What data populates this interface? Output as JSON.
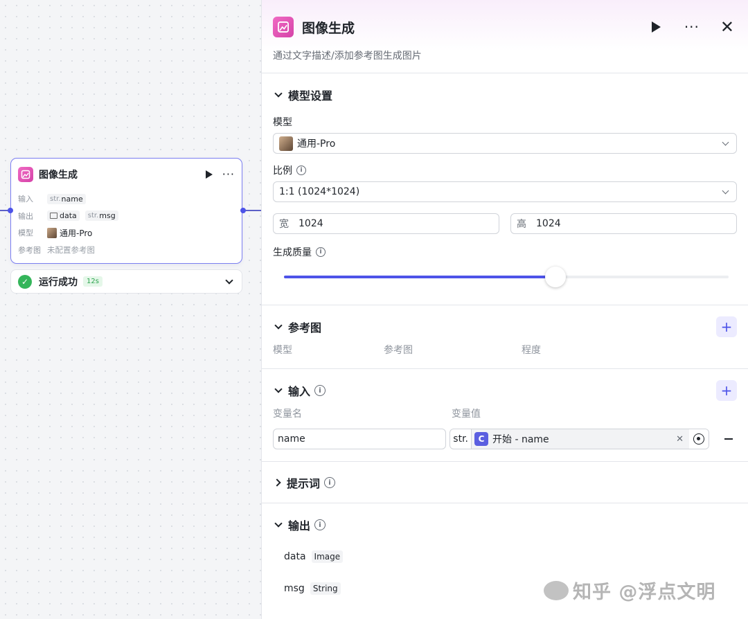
{
  "node": {
    "title": "图像生成",
    "input_label": "输入",
    "input_var_prefix": "str.",
    "input_var_name": "name",
    "output_label": "输出",
    "output_data_name": "data",
    "output_msg_prefix": "str.",
    "output_msg_name": "msg",
    "model_label": "模型",
    "model_value": "通用-Pro",
    "ref_label": "参考图",
    "ref_value": "未配置参考图"
  },
  "run_status": {
    "text": "运行成功",
    "duration": "12s"
  },
  "panel": {
    "title": "图像生成",
    "description": "通过文字描述/添加参考图生成图片",
    "model_section": {
      "title": "模型设置",
      "model_label": "模型",
      "model_value": "通用-Pro",
      "ratio_label": "比例",
      "ratio_value": "1:1 (1024*1024)",
      "width_label": "宽",
      "width_value": "1024",
      "height_label": "高",
      "height_value": "1024",
      "quality_label": "生成质量",
      "quality_level": 0.61
    },
    "ref_section": {
      "title": "参考图",
      "col_model": "模型",
      "col_ref": "参考图",
      "col_degree": "程度"
    },
    "input_section": {
      "title": "输入",
      "col_name": "变量名",
      "col_value": "变量值",
      "var_name": "name",
      "var_type": "str.",
      "var_ref": "开始 - name"
    },
    "prompt_section": {
      "title": "提示词"
    },
    "output_section": {
      "title": "输出",
      "outputs": [
        {
          "name": "data",
          "type": "Image"
        },
        {
          "name": "msg",
          "type": "String"
        }
      ]
    }
  },
  "watermark": "知乎 @浮点文明",
  "colors": {
    "accent": "#4d53e8",
    "success": "#34b55a",
    "node_icon": "#e356b8"
  }
}
